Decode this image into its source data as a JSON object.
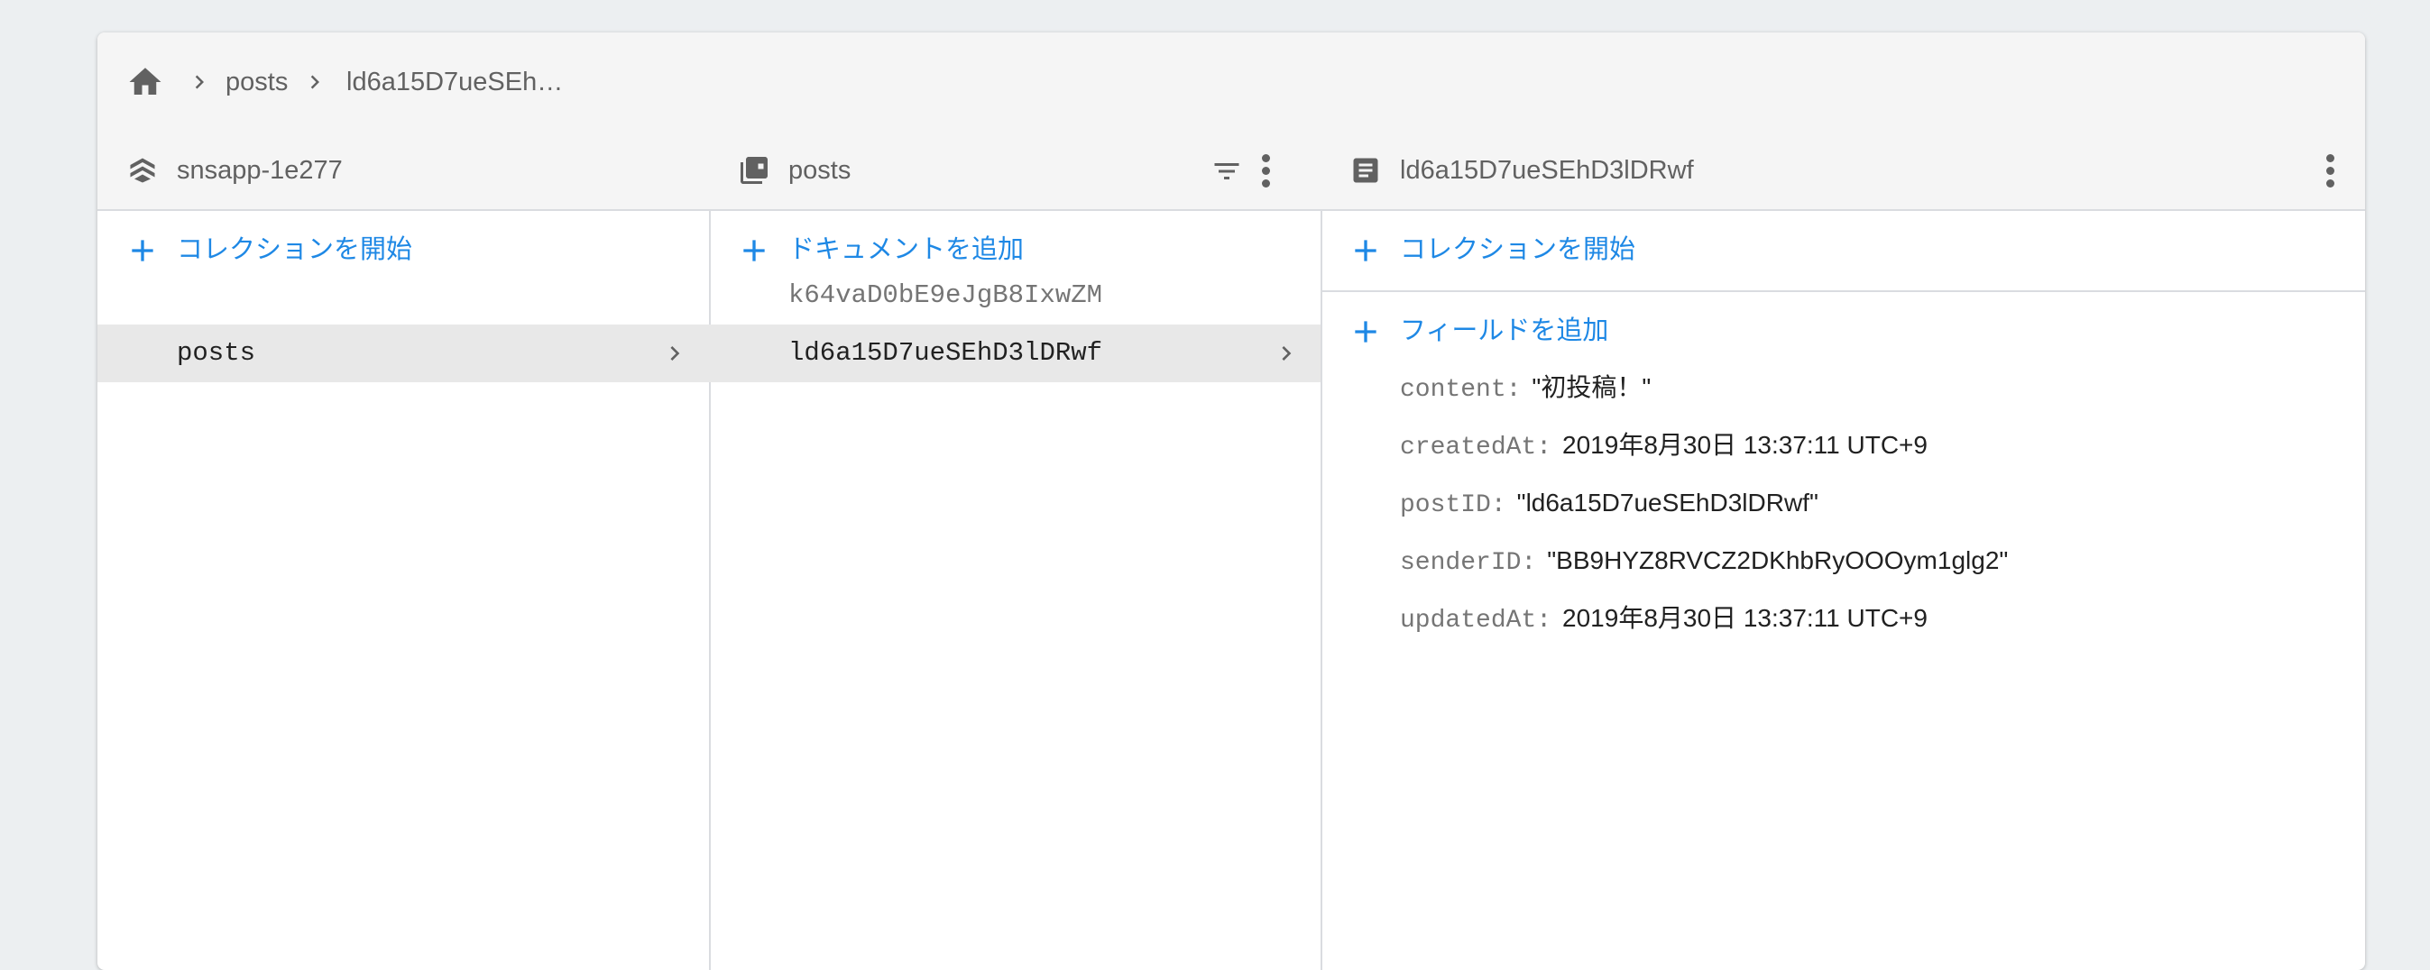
{
  "breadcrumb": {
    "items": [
      "posts",
      "ld6a15D7ueSEh…"
    ]
  },
  "columns": {
    "project": {
      "title": "snsapp-1e277",
      "action_label": "コレクションを開始",
      "items": [
        {
          "label": "posts",
          "selected": true
        }
      ]
    },
    "collection": {
      "title": "posts",
      "action_label": "ドキュメントを追加",
      "items": [
        {
          "label": "k64vaD0bE9eJgB8IxwZM",
          "selected": false
        },
        {
          "label": "ld6a15D7ueSEhD3lDRwf",
          "selected": true
        }
      ]
    },
    "document": {
      "title": "ld6a15D7ueSEhD3lDRwf",
      "start_collection_label": "コレクションを開始",
      "add_field_label": "フィールドを追加",
      "fields": [
        {
          "key": "content:",
          "value": "\"初投稿！\""
        },
        {
          "key": "createdAt:",
          "value": "2019年8月30日 13:37:11 UTC+9"
        },
        {
          "key": "postID:",
          "value": "\"ld6a15D7ueSEhD3lDRwf\""
        },
        {
          "key": "senderID:",
          "value": "\"BB9HYZ8RVCZ2DKhbRyOOOym1glg2\""
        },
        {
          "key": "updatedAt:",
          "value": "2019年8月30日 13:37:11 UTC+9"
        }
      ]
    }
  },
  "colors": {
    "accent": "#1e88e5",
    "selected_row": "#e8e8e8",
    "header_bg": "#f5f5f5"
  },
  "icons": {
    "home": "home-icon",
    "project": "firestore-stack-icon",
    "collection": "collection-icon",
    "document": "document-icon",
    "filter": "filter-icon",
    "more": "more-vert-icon",
    "add": "add-icon",
    "chevron": "chevron-right-icon"
  }
}
